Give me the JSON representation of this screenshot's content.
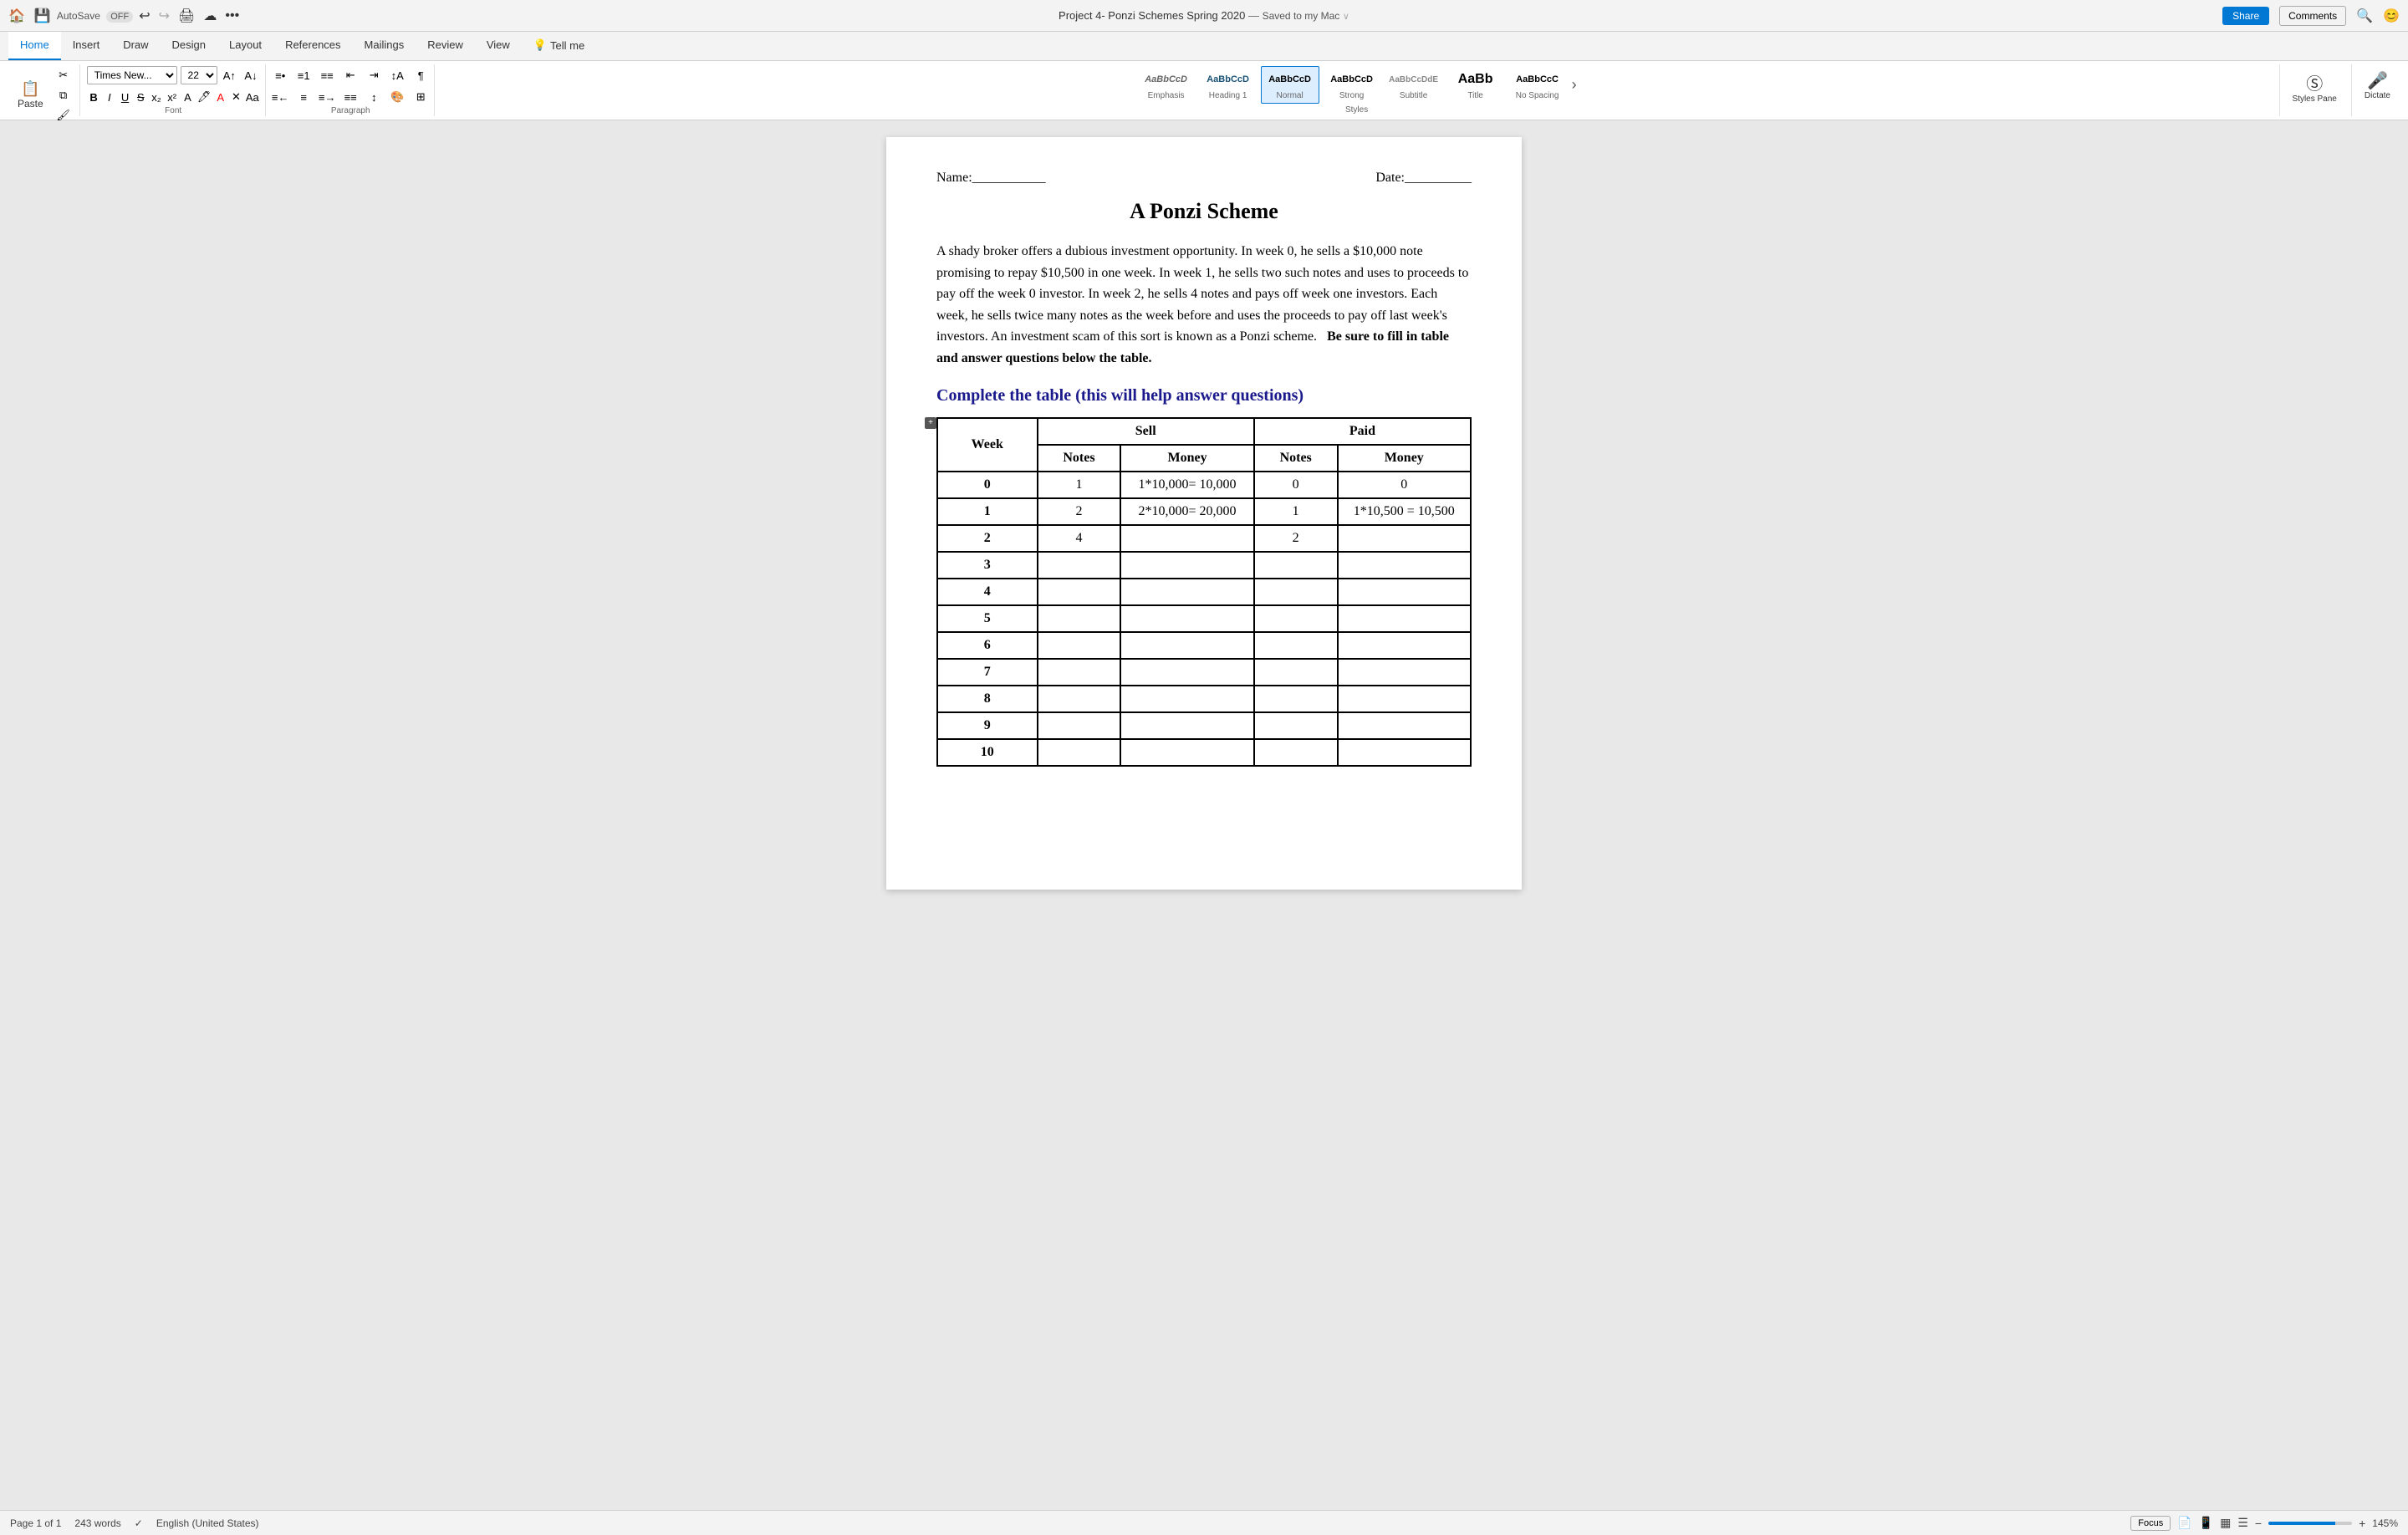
{
  "titleBar": {
    "autosave": "AutoSave",
    "autosaveState": "OFF",
    "docTitle": "Project 4- Ponzi Schemes Spring 2020",
    "savedState": "Saved to my Mac",
    "homeIcon": "🏠",
    "saveIcon": "💾",
    "undoIcon": "↩",
    "redoIcon": "↪",
    "printIcon": "🖨",
    "cloudIcon": "☁",
    "moreIcon": "•••"
  },
  "ribbon": {
    "tabs": [
      "Home",
      "Insert",
      "Draw",
      "Design",
      "Layout",
      "References",
      "Mailings",
      "Review",
      "View",
      "Tell me"
    ],
    "activeTab": "Home",
    "font": {
      "name": "Times New...",
      "size": "22"
    },
    "styles": [
      {
        "id": "emphasis",
        "preview": "AaBbCcD",
        "label": "Emphasis"
      },
      {
        "id": "heading1",
        "preview": "AaBbCcD",
        "label": "Heading 1"
      },
      {
        "id": "normal",
        "preview": "AaBbCcD",
        "label": "Normal",
        "active": true
      },
      {
        "id": "strong",
        "preview": "AaBbCcD",
        "label": "Strong"
      },
      {
        "id": "subtitle",
        "preview": "AaBbCcDdE",
        "label": "Subtitle"
      },
      {
        "id": "title",
        "preview": "AaBb",
        "label": "Title"
      },
      {
        "id": "nospacing",
        "preview": "AaBbCcC",
        "label": "No Spacing"
      }
    ],
    "stylesPane": "Styles Pane",
    "dictate": "Dictate"
  },
  "share": {
    "shareLabel": "Share",
    "commentsLabel": "Comments"
  },
  "document": {
    "nameLabel": "Name:___________",
    "dateLabel": "Date:__________",
    "title": "A Ponzi Scheme",
    "bodyText1": "A shady broker offers a dubious investment opportunity. In week 0, he sells a $10,000 note promising to repay $10,500 in one week. In week 1, he sells two such notes and uses to proceeds to pay off the week 0 investor. In week 2, he sells 4 notes and pays off week one investors. Each week, he sells twice many notes as the week before and uses the proceeds to pay off last week's investors. An investment scam of this sort is known as a Ponzi scheme.",
    "bodyText2Bold": "Be sure to fill in table and answer questions below the table.",
    "sectionTitle": "Complete the table (this will help answer questions)",
    "table": {
      "headers": {
        "week": "Week",
        "sell": "Sell",
        "sellNotes": "Notes",
        "sellMoney": "Money",
        "paid": "Paid",
        "paidNotes": "Notes",
        "paidMoney": "Money"
      },
      "rows": [
        {
          "week": "0",
          "sellNotes": "1",
          "sellMoney": "1*10,000= 10,000",
          "paidNotes": "0",
          "paidMoney": "0"
        },
        {
          "week": "1",
          "sellNotes": "2",
          "sellMoney": "2*10,000= 20,000",
          "paidNotes": "1",
          "paidMoney": "1*10,500 = 10,500"
        },
        {
          "week": "2",
          "sellNotes": "4",
          "sellMoney": "",
          "paidNotes": "2",
          "paidMoney": ""
        },
        {
          "week": "3",
          "sellNotes": "",
          "sellMoney": "",
          "paidNotes": "",
          "paidMoney": ""
        },
        {
          "week": "4",
          "sellNotes": "",
          "sellMoney": "",
          "paidNotes": "",
          "paidMoney": ""
        },
        {
          "week": "5",
          "sellNotes": "",
          "sellMoney": "",
          "paidNotes": "",
          "paidMoney": ""
        },
        {
          "week": "6",
          "sellNotes": "",
          "sellMoney": "",
          "paidNotes": "",
          "paidMoney": ""
        },
        {
          "week": "7",
          "sellNotes": "",
          "sellMoney": "",
          "paidNotes": "",
          "paidMoney": ""
        },
        {
          "week": "8",
          "sellNotes": "",
          "sellMoney": "",
          "paidNotes": "",
          "paidMoney": ""
        },
        {
          "week": "9",
          "sellNotes": "",
          "sellMoney": "",
          "paidNotes": "",
          "paidMoney": ""
        },
        {
          "week": "10",
          "sellNotes": "",
          "sellMoney": "",
          "paidNotes": "",
          "paidMoney": ""
        }
      ]
    }
  },
  "statusBar": {
    "page": "Page 1 of 1",
    "words": "243 words",
    "language": "English (United States)",
    "focusBtn": "Focus",
    "zoom": "145%"
  }
}
